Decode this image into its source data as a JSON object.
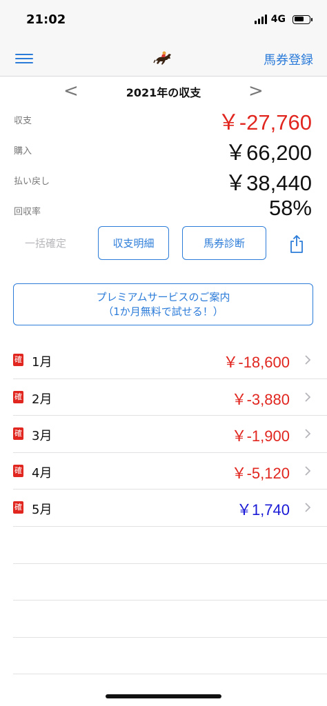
{
  "status_bar": {
    "time": "21:02",
    "network": "4G",
    "battery_level": 0.65
  },
  "nav": {
    "right_label": "馬券登録",
    "menu_icon": "hamburger-icon",
    "logo_icon": "horse-racing-icon"
  },
  "year_header": {
    "prev": "<",
    "title": "2021年の収支",
    "next": ">"
  },
  "summary": [
    {
      "label": "収支",
      "value": "￥-27,760",
      "color": "#e0261f"
    },
    {
      "label": "購入",
      "value": "￥66,200",
      "color": "#111111"
    },
    {
      "label": "払い戻し",
      "value": "￥38,440",
      "color": "#111111"
    },
    {
      "label": "回収率",
      "value": "58%",
      "color": "#111111"
    }
  ],
  "actions": {
    "bulk_confirm": "一括確定",
    "detail_button": "収支明細",
    "diagnosis_button": "馬券診断",
    "share_icon": "share-icon"
  },
  "premium": {
    "line1": "プレミアムサービスのご案内",
    "line2": "（1か月無料で試せる！）"
  },
  "months": [
    {
      "badge": "確",
      "name": "1月",
      "amount": "￥-18,600",
      "color": "#e0261f"
    },
    {
      "badge": "確",
      "name": "2月",
      "amount": "￥-3,880",
      "color": "#e0261f"
    },
    {
      "badge": "確",
      "name": "3月",
      "amount": "￥-1,900",
      "color": "#e0261f"
    },
    {
      "badge": "確",
      "name": "4月",
      "amount": "￥-5,120",
      "color": "#e0261f"
    },
    {
      "badge": "確",
      "name": "5月",
      "amount": "￥1,740",
      "color": "#1a1ad6"
    }
  ],
  "colors": {
    "accent": "#2b7bd9",
    "negative": "#e0261f",
    "positive": "#1a1ad6"
  }
}
